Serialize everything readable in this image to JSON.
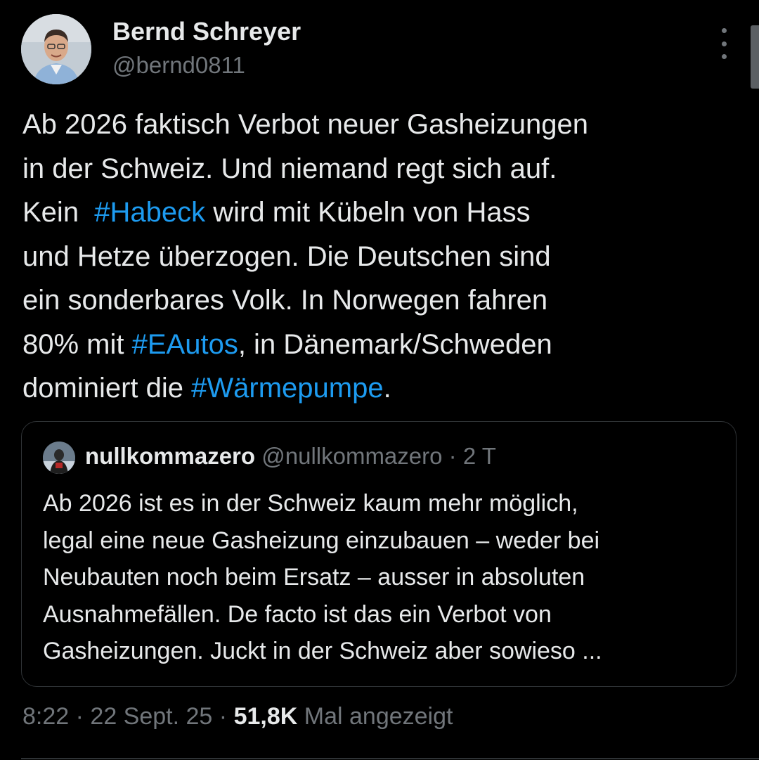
{
  "author": {
    "name": "Bernd Schreyer",
    "handle": "@bernd0811"
  },
  "colors": {
    "background": "#000000",
    "text": "#e7e9ea",
    "secondary_text": "#71767b",
    "hashtag": "#1d9bf0",
    "border": "#2f3336"
  },
  "icons": {
    "more": "more-vertical-icon"
  },
  "tweet": {
    "lines": [
      [
        {
          "text": "Ab 2026 faktisch Verbot neuer Gasheizungen"
        }
      ],
      [
        {
          "text": "in der Schweiz. Und niemand regt sich auf."
        }
      ],
      [
        {
          "text": "Kein  "
        },
        {
          "hashtag": "#Habeck"
        },
        {
          "text": " wird mit Kübeln von Hass"
        }
      ],
      [
        {
          "text": "und Hetze überzogen. Die Deutschen sind"
        }
      ],
      [
        {
          "text": "ein sonderbares Volk. In Norwegen fahren"
        }
      ],
      [
        {
          "text": "80% mit "
        },
        {
          "hashtag": "#EAutos"
        },
        {
          "text": ", in Dänemark/Schweden"
        }
      ],
      [
        {
          "text": "dominiert die "
        },
        {
          "hashtag": "#Wärmepumpe"
        },
        {
          "text": "."
        }
      ]
    ]
  },
  "quote": {
    "name": "nullkommazero",
    "handle": "@nullkommazero",
    "separator": "·",
    "time": "2 T",
    "lines": [
      "Ab 2026 ist es in der Schweiz kaum mehr möglich,",
      "legal eine neue Gasheizung einzubauen – weder bei",
      "Neubauten noch beim Ersatz – ausser in absoluten",
      "Ausnahmefällen. De facto ist das ein Verbot von",
      "Gasheizungen. Juckt in der Schweiz aber sowieso ..."
    ]
  },
  "meta": {
    "time": "8:22",
    "separator": "·",
    "date": "22 Sept. 25",
    "views_count": "51,8K",
    "views_label": "Mal angezeigt"
  }
}
